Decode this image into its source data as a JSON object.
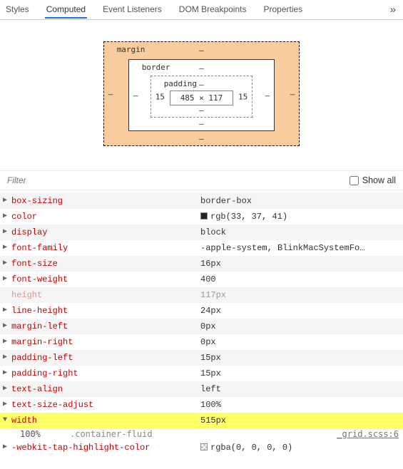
{
  "tabs": {
    "items": [
      "Styles",
      "Computed",
      "Event Listeners",
      "DOM Breakpoints",
      "Properties"
    ],
    "active": 1,
    "more_glyph": "»"
  },
  "boxmodel": {
    "margin_label": "margin",
    "border_label": "border",
    "padding_label": "padding",
    "content": "485 × 117",
    "margin": {
      "top": "–",
      "right": "–",
      "bottom": "–",
      "left": "–"
    },
    "border": {
      "top": "–",
      "right": "–",
      "bottom": "–",
      "left": "–"
    },
    "padding": {
      "top": "–",
      "right": "15",
      "bottom": "–",
      "left": "15"
    }
  },
  "filter": {
    "placeholder": "Filter",
    "showall_label": "Show all"
  },
  "props": [
    {
      "name": "box-sizing",
      "value": "border-box"
    },
    {
      "name": "color",
      "value": "rgb(33, 37, 41)",
      "swatch": "#212529"
    },
    {
      "name": "display",
      "value": "block"
    },
    {
      "name": "font-family",
      "value": "-apple-system, BlinkMacSystemFo…"
    },
    {
      "name": "font-size",
      "value": "16px"
    },
    {
      "name": "font-weight",
      "value": "400"
    },
    {
      "name": "height",
      "value": "117px",
      "faded": true
    },
    {
      "name": "line-height",
      "value": "24px"
    },
    {
      "name": "margin-left",
      "value": "0px"
    },
    {
      "name": "margin-right",
      "value": "0px"
    },
    {
      "name": "padding-left",
      "value": "15px"
    },
    {
      "name": "padding-right",
      "value": "15px"
    },
    {
      "name": "text-align",
      "value": "left"
    },
    {
      "name": "text-size-adjust",
      "value": "100%"
    },
    {
      "name": "width",
      "value": "515px",
      "highlight": true,
      "expanded": true
    }
  ],
  "cascade": {
    "value": "100%",
    "selector": ".container-fluid",
    "source": "_grid.scss:6"
  },
  "trailing": {
    "name": "-webkit-tap-highlight-color",
    "value": "rgba(0, 0, 0, 0)",
    "swatch": "checker"
  }
}
